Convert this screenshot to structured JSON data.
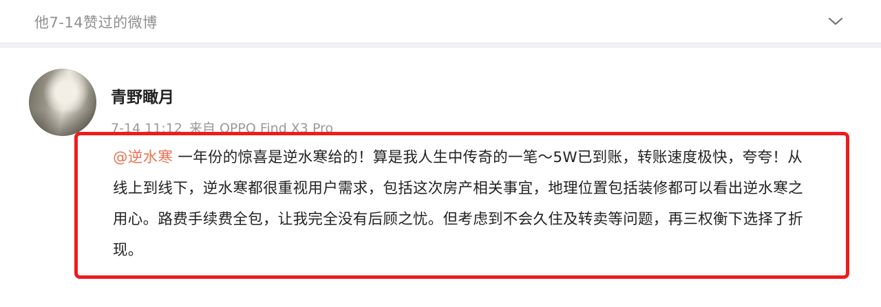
{
  "header": {
    "title": "他7-14赞过的微博"
  },
  "post": {
    "username": "青野瞰月",
    "time": "7-14 11:12",
    "source_label": "来自 OPPO Find X3 Pro",
    "mention": "@逆水寒",
    "text": " 一年份的惊喜是逆水寒给的！算是我人生中传奇的一笔～5W已到账，转账速度极快，夸夸！从线上到线下，逆水寒都很重视用户需求，包括这次房产相关事宜，地理位置包括装修都可以看出逆水寒之用心。路费手续费全包，让我完全没有后顾之忧。但考虑到不会久住及转卖等问题，再三权衡下选择了折现。"
  },
  "colors": {
    "highlight_border": "#ee1c1c",
    "mention": "#eb7350"
  },
  "icons": {
    "collapse": "chevron-down-icon"
  }
}
